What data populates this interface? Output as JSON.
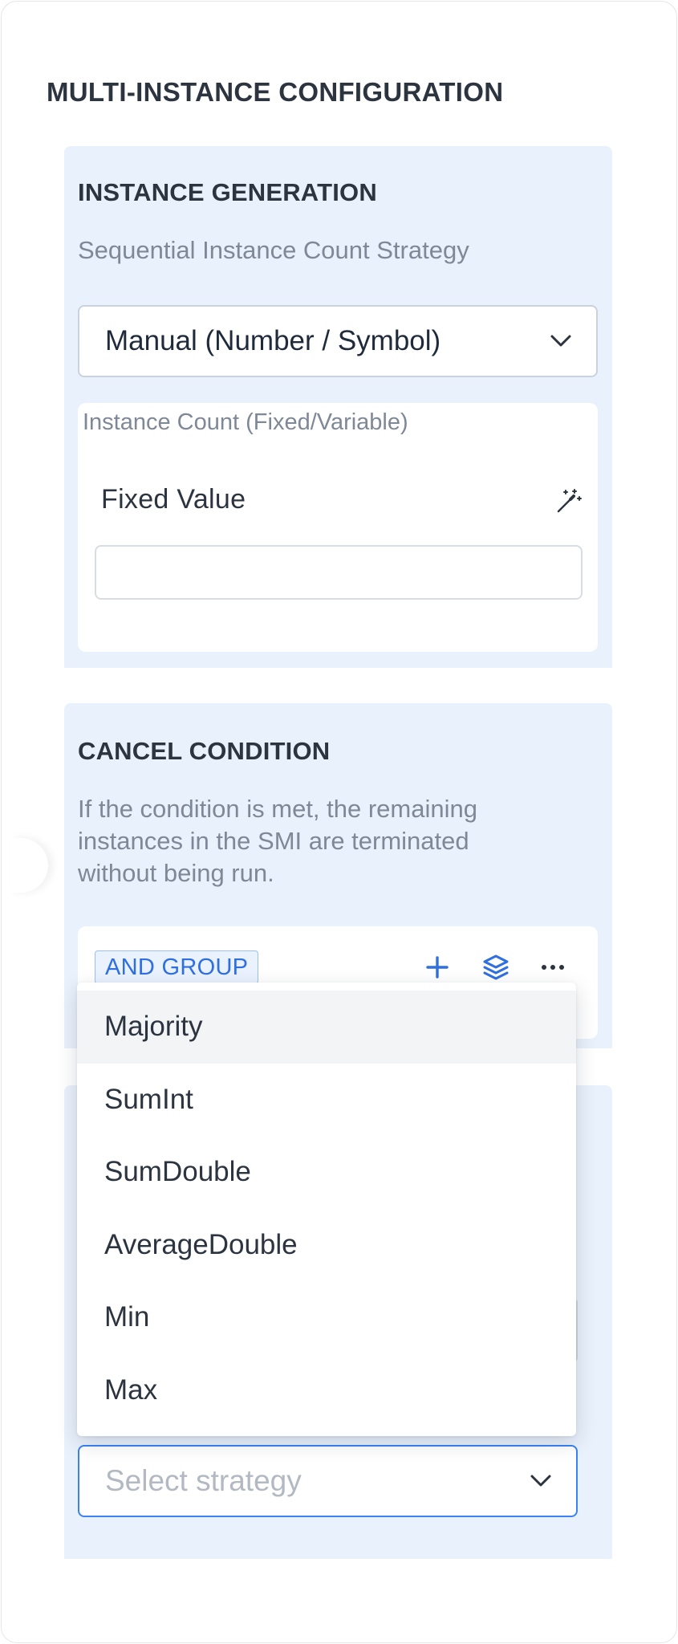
{
  "section_title": "MULTI-INSTANCE CONFIGURATION",
  "instance_generation": {
    "title": "INSTANCE GENERATION",
    "subtitle": "Sequential Instance Count Strategy",
    "select_value": "Manual (Number / Symbol)",
    "count_card": {
      "label": "Instance Count (Fixed/Variable)",
      "fixed_label": "Fixed Value",
      "input_value": ""
    }
  },
  "cancel_condition": {
    "title": "CANCEL CONDITION",
    "description_lines": [
      "If the condition is met, the remaining",
      "instances in the SMI are terminated",
      "without being run."
    ],
    "group_chip": "AND GROUP"
  },
  "strategy_dropdown": {
    "options": [
      "Majority",
      "SumInt",
      "SumDouble",
      "AverageDouble",
      "Min",
      "Max"
    ],
    "highlighted": "Majority",
    "placeholder": "Select strategy"
  },
  "colors": {
    "panel_bg": "#e9f1fc",
    "accent": "#3b82f6",
    "chip_text": "#2f6fe0"
  },
  "icons": [
    "chevron-down-icon",
    "magic-wand-icon",
    "plus-icon",
    "layers-icon",
    "more-horizontal-icon"
  ]
}
